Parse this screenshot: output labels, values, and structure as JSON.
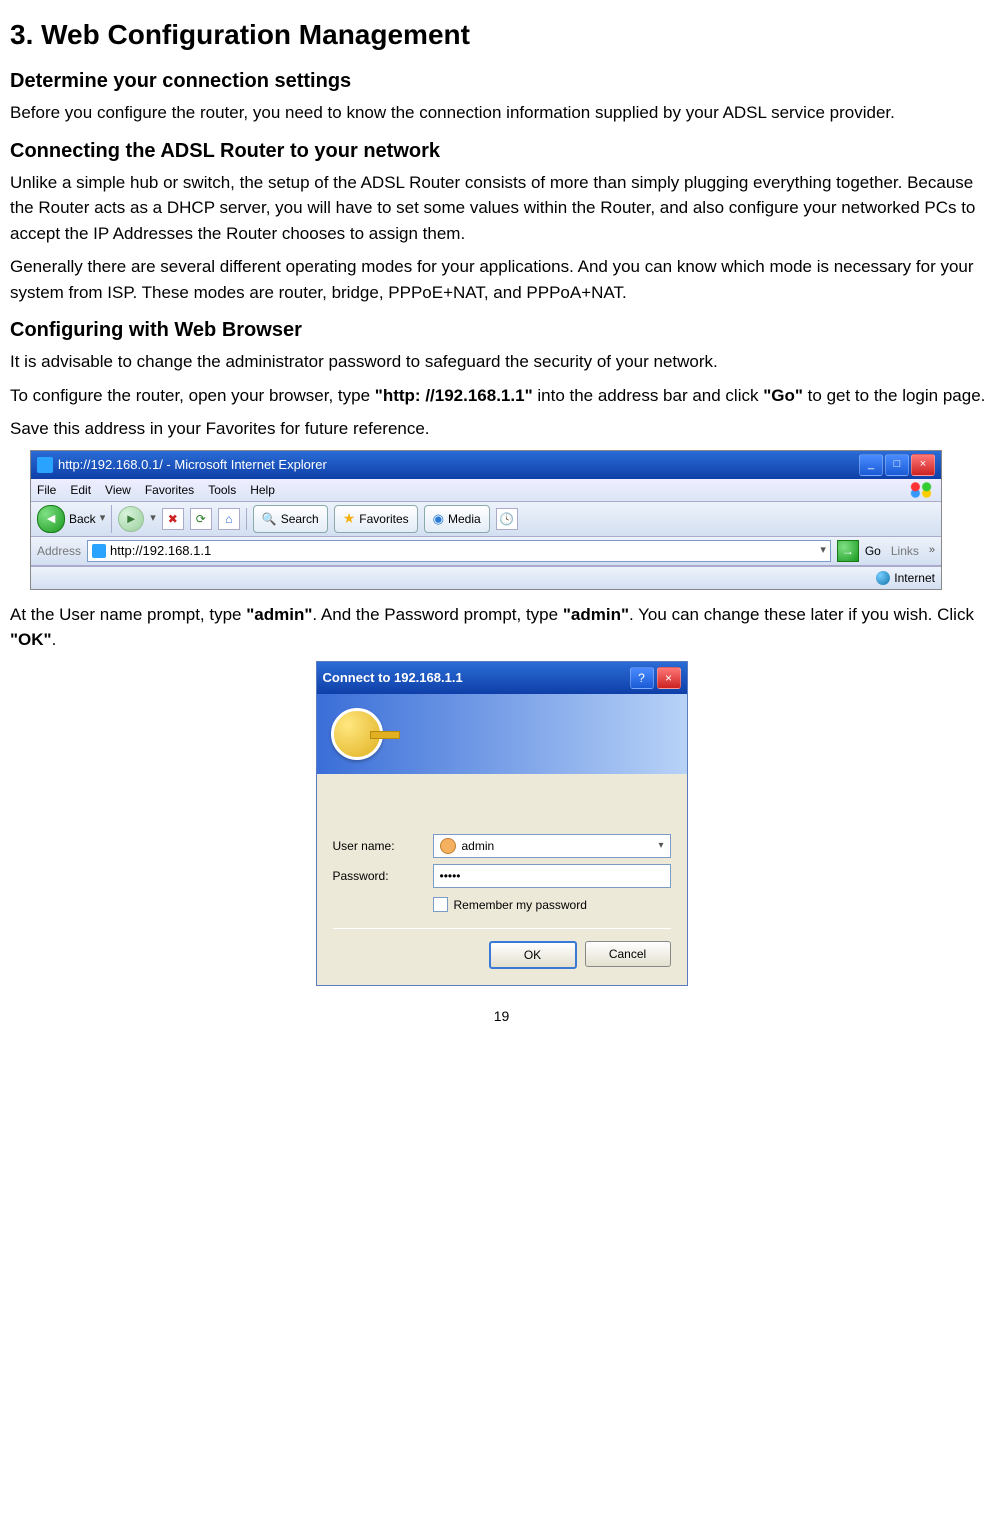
{
  "h1": "3. Web Configuration Management",
  "s1_title": "Determine your connection settings",
  "s1_p1": "Before you configure the router, you need to know the connection information supplied by your ADSL service provider.",
  "s2_title": "Connecting the ADSL Router to your network",
  "s2_p1": "Unlike a simple hub or switch, the setup of the ADSL Router consists of more than simply plugging everything together. Because the Router acts as a DHCP server, you will have to set some values within the Router, and also configure your networked PCs to accept the IP Addresses the Router chooses to assign them.",
  "s2_p2": "Generally there are several different operating modes for your applications. And you can know which mode is necessary for your system from ISP. These modes are router, bridge, PPPoE+NAT, and PPPoA+NAT.",
  "s3_title": "Configuring with Web Browser",
  "s3_p1": "It is advisable to change the administrator password to safeguard the security of your network.",
  "s3_p2a": "To configure the router, open your browser, type ",
  "s3_p2b": "\"http: //192.168.1.1\"",
  "s3_p2c": " into the address bar and click ",
  "s3_p2d": "\"Go\"",
  "s3_p2e": " to get to the login page.",
  "s3_p3": "Save this address in your Favorites for future reference.",
  "s4_p1a": "At the User name prompt, type ",
  "s4_p1b": "\"admin\"",
  "s4_p1c": ". And the Password prompt, type ",
  "s4_p1d": "\"admin\"",
  "s4_p1e": ". You can change these later if you wish. Click ",
  "s4_p1f": "\"OK\"",
  "s4_p1g": ".",
  "ie": {
    "title": "http://192.168.0.1/ - Microsoft Internet Explorer",
    "menu": {
      "file": "File",
      "edit": "Edit",
      "view": "View",
      "fav": "Favorites",
      "tools": "Tools",
      "help": "Help"
    },
    "toolbar": {
      "back": "Back",
      "search": "Search",
      "favorites": "Favorites",
      "media": "Media"
    },
    "addr_label": "Address",
    "addr_value": "http://192.168.1.1",
    "go": "Go",
    "links": "Links",
    "status": "Internet"
  },
  "dlg": {
    "title": "Connect to 192.168.1.1",
    "user_label": "User name:",
    "user_value": "admin",
    "pass_label": "Password:",
    "pass_value": "•••••",
    "remember": "Remember my password",
    "ok": "OK",
    "cancel": "Cancel"
  },
  "page_num": "19"
}
